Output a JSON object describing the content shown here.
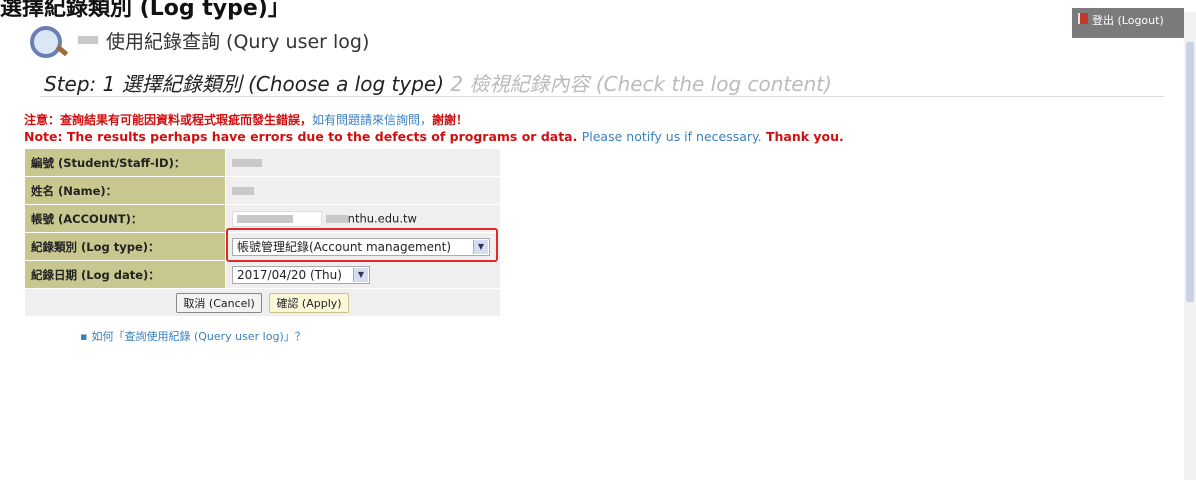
{
  "top_cut_text": "選擇紀錄類別 (Log type)」",
  "logout_label": "登出 (Logout)",
  "page_title": "使用紀錄查詢 (Qury user log)",
  "steps": {
    "step_label": "Step: 1",
    "step1": "選擇紀錄類別 (Choose a log type)",
    "step2": "2 檢視紀錄內容 (Check the log content)"
  },
  "notice": {
    "zh_red": "注意：查詢結果有可能因資料或程式瑕疵而發生錯誤，",
    "zh_blue": "如有問題請來信詢問，",
    "zh_red_end": "謝謝！",
    "en_red": "Note: The results perhaps have errors due to the defects of programs or data.",
    "en_blue": "Please notify us if necessary.",
    "en_red_end": "Thank you."
  },
  "form": {
    "id_label": "編號 (Student/Staff-ID)：",
    "name_label": "姓名 (Name)：",
    "account_label": "帳號 (ACCOUNT)：",
    "account_domain": "nthu.edu.tw",
    "logtype_label": "紀錄類別 (Log type)：",
    "logtype_value": "帳號管理紀錄(Account management)",
    "logdate_label": "紀錄日期 (Log date)：",
    "logdate_value": "2017/04/20 (Thu)",
    "cancel_label": "取消 (Cancel)",
    "apply_label": "確認 (Apply)"
  },
  "help_link": "如何「查詢使用紀錄 (Query user log)」？",
  "colors": {
    "label_bg": "#c7c78f",
    "value_bg": "#efefef",
    "highlight": "#e02a2a",
    "notice_red": "#d01010",
    "link_blue": "#3a7fbf"
  }
}
